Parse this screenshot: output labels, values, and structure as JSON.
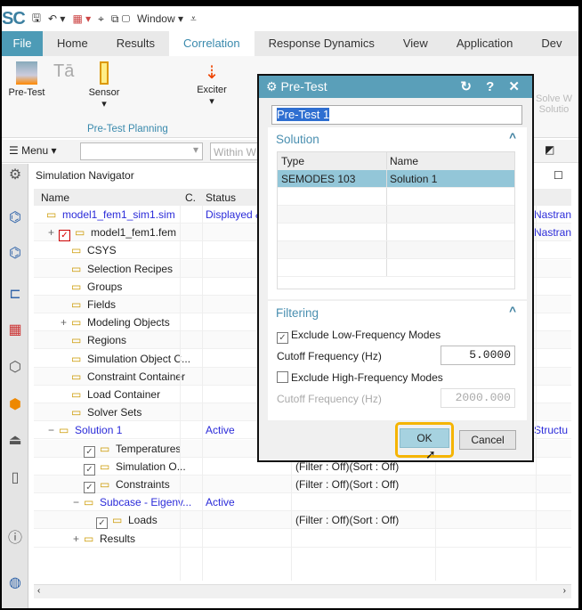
{
  "qat": {
    "logo": "SC",
    "window_menu": "Window ▾"
  },
  "tabs": [
    "File",
    "Home",
    "Results",
    "Correlation",
    "Response Dynamics",
    "View",
    "Application",
    "Dev"
  ],
  "active_tab": "Correlation",
  "ribbon": {
    "pretest": "Pre-Test",
    "sensor": "Sensor",
    "exciter": "Exciter",
    "group": "Pre-Test Planning",
    "solve": "Solve W",
    "solve2": "Solutio"
  },
  "toolbar": {
    "menu": "Menu ▾",
    "filter_placeholder": "Within W"
  },
  "navigator": {
    "title": "Simulation Navigator",
    "columns": [
      "Name",
      "C.",
      "Status"
    ],
    "rows": [
      {
        "name": "model1_fem1_sim1.sim",
        "status": "Displayed &",
        "right": "Nastran",
        "link": true,
        "indent": 0,
        "expander": ""
      },
      {
        "name": "model1_fem1.fem",
        "status": "",
        "right": "Nastran",
        "indent": 1,
        "expander": "+",
        "check": "red"
      },
      {
        "name": "CSYS",
        "indent": 2
      },
      {
        "name": "Selection Recipes",
        "indent": 2
      },
      {
        "name": "Groups",
        "indent": 2
      },
      {
        "name": "Fields",
        "indent": 2
      },
      {
        "name": "Modeling Objects",
        "indent": 2,
        "expander": "+"
      },
      {
        "name": "Regions",
        "indent": 2
      },
      {
        "name": "Simulation Object C...",
        "indent": 2
      },
      {
        "name": "Constraint Container",
        "indent": 2
      },
      {
        "name": "Load Container",
        "indent": 2
      },
      {
        "name": "Solver Sets",
        "indent": 2
      },
      {
        "name": "Solution 1",
        "status": "Active",
        "right": "Structu",
        "link": true,
        "indent": 1,
        "expander": "−"
      },
      {
        "name": "Temperatures",
        "indent": 3,
        "check": "gray"
      },
      {
        "name": "Simulation O...",
        "status": "(Filter : Off)(Sort : Off)",
        "indent": 3,
        "check": "gray"
      },
      {
        "name": "Constraints",
        "status": "(Filter : Off)(Sort : Off)",
        "indent": 3,
        "check": "gray"
      },
      {
        "name": "Subcase - Eigenv...",
        "status": "Active",
        "link": true,
        "indent": 3,
        "expander": "−"
      },
      {
        "name": "Loads",
        "status": "(Filter : Off)(Sort : Off)",
        "indent": 4,
        "check": "gray"
      },
      {
        "name": "Results",
        "indent": 3,
        "expander": "+"
      }
    ]
  },
  "dialog": {
    "title": "Pre-Test",
    "controls": "↻ ? ✕",
    "name_value": "Pre-Test 1",
    "solution_header": "Solution",
    "table_columns": [
      "Type",
      "Name"
    ],
    "table_rows": [
      [
        "SEMODES 103",
        "Solution 1"
      ]
    ],
    "filtering_header": "Filtering",
    "exclude_low": "Exclude Low-Frequency Modes",
    "exclude_low_checked": true,
    "cutoff_label": "Cutoff Frequency (Hz)",
    "cutoff_low": "5.0000",
    "exclude_high": "Exclude High-Frequency Modes",
    "exclude_high_checked": false,
    "cutoff_high": "2000.000",
    "ok": "OK",
    "cancel": "Cancel"
  },
  "colors": {
    "accent": "#4d9bb6",
    "highlight": "#f5b400",
    "link": "#2b2bd9"
  }
}
